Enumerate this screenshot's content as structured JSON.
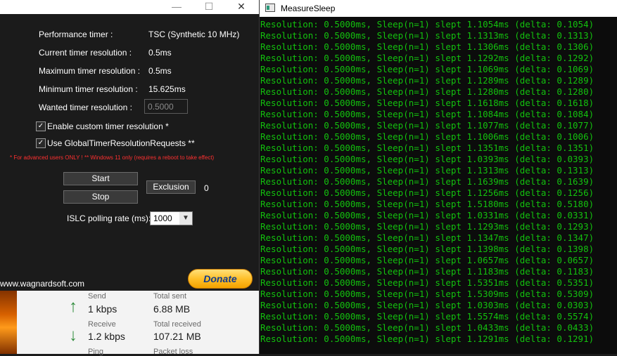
{
  "islc": {
    "perf_timer_label": "Performance timer :",
    "perf_timer_value": "TSC (Synthetic 10 MHz)",
    "current_res_label": "Current timer resolution :",
    "current_res_value": "0.5ms",
    "max_res_label": "Maximum timer resolution :",
    "max_res_value": "0.5ms",
    "min_res_label": "Minimum timer resolution :",
    "min_res_value": "15.625ms",
    "wanted_res_label": "Wanted timer resolution :",
    "wanted_res_value": "0.5000",
    "enable_custom_label": "Enable custom timer resolution *",
    "enable_custom_checked": true,
    "global_requests_label": "Use GlobalTimerResolutionRequests **",
    "global_requests_checked": true,
    "warning_text": "* For advanced users ONLY !  ** Windows 11 only (requires a reboot to take effect)",
    "start_label": "Start",
    "stop_label": "Stop",
    "exclusion_label": "Exclusion",
    "exclusion_count": "0",
    "polling_label": "ISLC polling rate (ms):",
    "polling_value": "1000",
    "website": "www.wagnardsoft.com",
    "donate_label": "Donate",
    "titlebar_minimize": "—",
    "titlebar_maximize": "☐",
    "titlebar_close": "✕"
  },
  "network": {
    "send_label": "Send",
    "send_value": "1 kbps",
    "total_sent_label": "Total sent",
    "total_sent_value": "6.88 MB",
    "receive_label": "Receive",
    "receive_value": "1.2 kbps",
    "total_received_label": "Total received",
    "total_received_value": "107.21 MB",
    "ping_label": "Ping",
    "packet_loss_label": "Packet loss"
  },
  "console": {
    "title": "MeasureSleep",
    "lines": [
      "Resolution: 0.5000ms, Sleep(n=1) slept 1.1054ms (delta: 0.1054)",
      "Resolution: 0.5000ms, Sleep(n=1) slept 1.1313ms (delta: 0.1313)",
      "Resolution: 0.5000ms, Sleep(n=1) slept 1.1306ms (delta: 0.1306)",
      "Resolution: 0.5000ms, Sleep(n=1) slept 1.1292ms (delta: 0.1292)",
      "Resolution: 0.5000ms, Sleep(n=1) slept 1.1069ms (delta: 0.1069)",
      "Resolution: 0.5000ms, Sleep(n=1) slept 1.1289ms (delta: 0.1289)",
      "Resolution: 0.5000ms, Sleep(n=1) slept 1.1280ms (delta: 0.1280)",
      "Resolution: 0.5000ms, Sleep(n=1) slept 1.1618ms (delta: 0.1618)",
      "Resolution: 0.5000ms, Sleep(n=1) slept 1.1084ms (delta: 0.1084)",
      "Resolution: 0.5000ms, Sleep(n=1) slept 1.1077ms (delta: 0.1077)",
      "Resolution: 0.5000ms, Sleep(n=1) slept 1.1006ms (delta: 0.1006)",
      "Resolution: 0.5000ms, Sleep(n=1) slept 1.1351ms (delta: 0.1351)",
      "Resolution: 0.5000ms, Sleep(n=1) slept 1.0393ms (delta: 0.0393)",
      "Resolution: 0.5000ms, Sleep(n=1) slept 1.1313ms (delta: 0.1313)",
      "Resolution: 0.5000ms, Sleep(n=1) slept 1.1639ms (delta: 0.1639)",
      "Resolution: 0.5000ms, Sleep(n=1) slept 1.1256ms (delta: 0.1256)",
      "Resolution: 0.5000ms, Sleep(n=1) slept 1.5180ms (delta: 0.5180)",
      "Resolution: 0.5000ms, Sleep(n=1) slept 1.0331ms (delta: 0.0331)",
      "Resolution: 0.5000ms, Sleep(n=1) slept 1.1293ms (delta: 0.1293)",
      "Resolution: 0.5000ms, Sleep(n=1) slept 1.1347ms (delta: 0.1347)",
      "Resolution: 0.5000ms, Sleep(n=1) slept 1.1398ms (delta: 0.1398)",
      "Resolution: 0.5000ms, Sleep(n=1) slept 1.0657ms (delta: 0.0657)",
      "Resolution: 0.5000ms, Sleep(n=1) slept 1.1183ms (delta: 0.1183)",
      "Resolution: 0.5000ms, Sleep(n=1) slept 1.5351ms (delta: 0.5351)",
      "Resolution: 0.5000ms, Sleep(n=1) slept 1.5309ms (delta: 0.5309)",
      "Resolution: 0.5000ms, Sleep(n=1) slept 1.0303ms (delta: 0.0303)",
      "Resolution: 0.5000ms, Sleep(n=1) slept 1.5574ms (delta: 0.5574)",
      "Resolution: 0.5000ms, Sleep(n=1) slept 1.0433ms (delta: 0.0433)",
      "Resolution: 0.5000ms, Sleep(n=1) slept 1.1291ms (delta: 0.1291)"
    ],
    "text_color": "#13c10e"
  }
}
